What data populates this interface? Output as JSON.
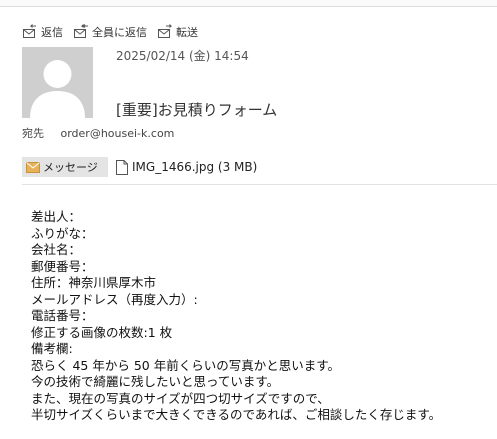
{
  "toolbar": {
    "reply": "返信",
    "reply_all": "全員に返信",
    "forward": "転送"
  },
  "message": {
    "date": "2025/02/14 (金) 14:54",
    "subject": "[重要]お見積りフォーム",
    "to_label": "宛先",
    "to_address": "order@housei-k.com"
  },
  "attachments": {
    "message_tab": "メッセージ",
    "file": "IMG_1466.jpg (3 MB)"
  },
  "body_lines": [
    "差出人：",
    "ふりがな：",
    "会社名：",
    "郵便番号：",
    "住所：神奈川県厚木市",
    "メールアドレス（再度入力）:",
    "電話番号：",
    "修正する画像の枚数:1 枚",
    "備考欄:",
    "恐らく 45 年から 50 年前くらいの写真かと思います。",
    "今の技術で綺麗に残したいと思っています。",
    "また、現在の写真のサイズが四つ切サイズですので、",
    "半切サイズくらいまで大きくできるのであれば、ご相談したく存じます。"
  ],
  "colors": {
    "avatar_bg": "#cfcfcf",
    "tab_bg": "#e4e4e4",
    "mail_icon": "#e6b35a"
  }
}
